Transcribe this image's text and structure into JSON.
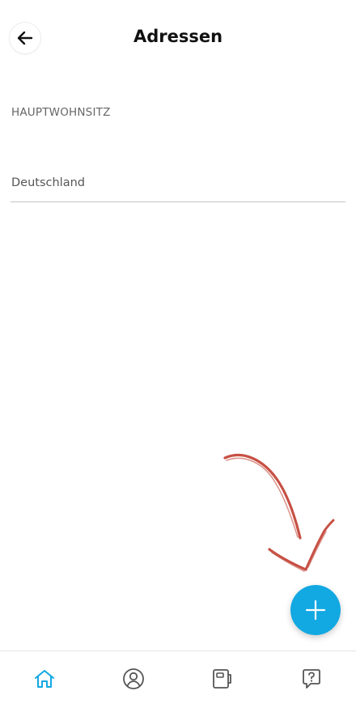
{
  "header": {
    "title": "Adressen",
    "back_icon": "arrow-left-icon"
  },
  "main": {
    "section_label": "HAUPTWOHNSITZ",
    "country_value": "Deutschland"
  },
  "fab": {
    "icon": "plus-icon",
    "color": "#12a8e2"
  },
  "bottom_nav": {
    "items": [
      {
        "icon": "home-icon",
        "active": true
      },
      {
        "icon": "profile-icon",
        "active": false
      },
      {
        "icon": "documents-icon",
        "active": false
      },
      {
        "icon": "help-icon",
        "active": false
      }
    ],
    "active_color": "#12a8e2",
    "inactive_color": "#555555"
  },
  "colors": {
    "accent": "#12a8e2",
    "annotation": "#c0392b"
  }
}
